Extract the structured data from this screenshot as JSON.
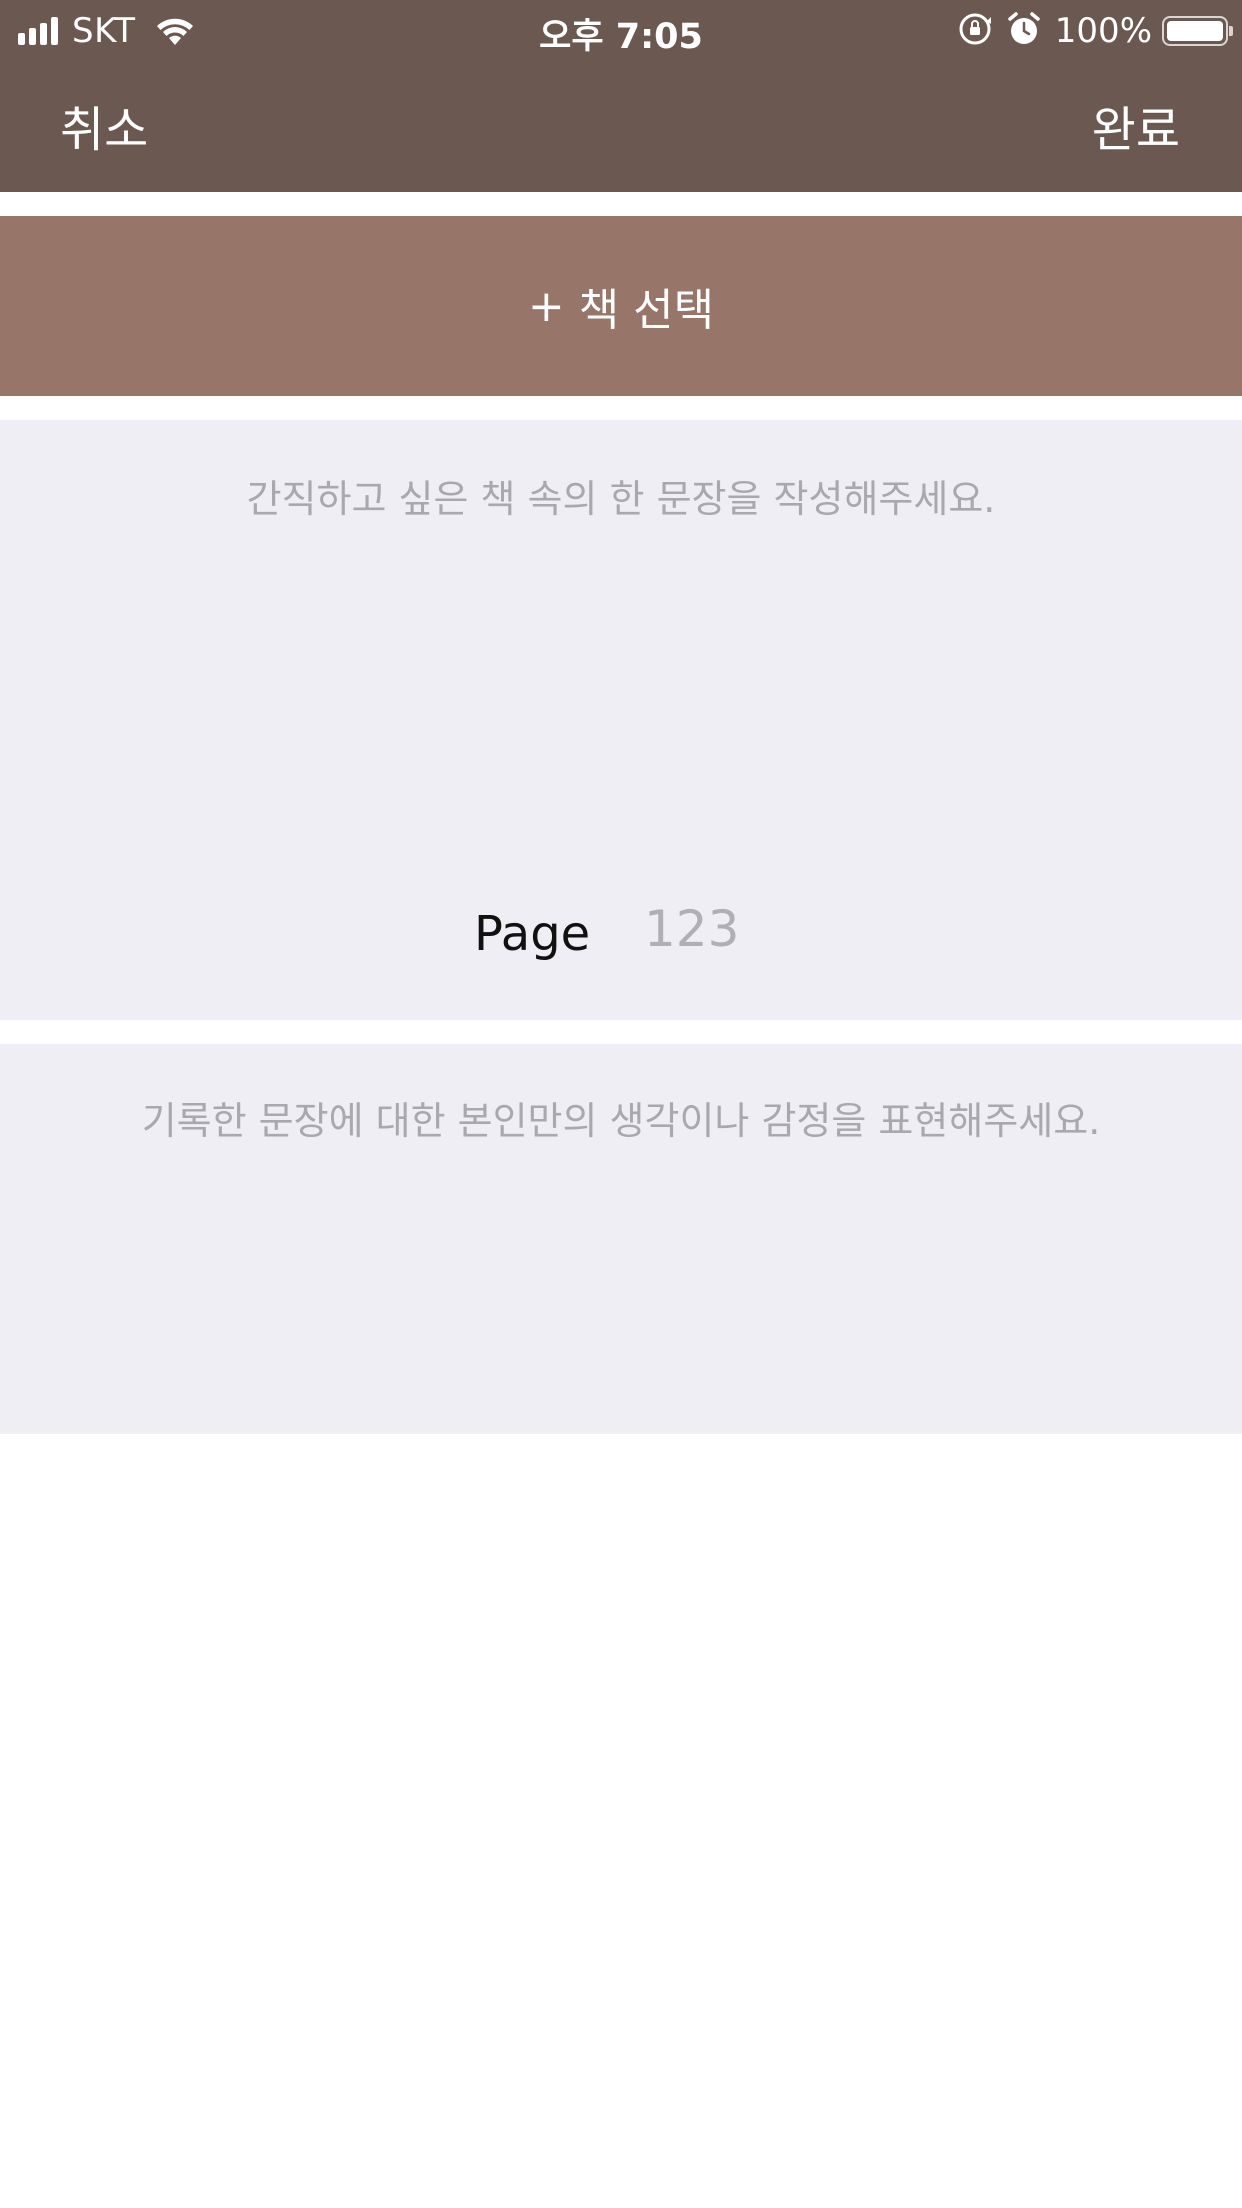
{
  "status_bar": {
    "carrier": "SKT",
    "time": "오후 7:05",
    "battery_percent": "100%",
    "battery_level": 1.0,
    "icons": [
      "signal-bars-icon",
      "wifi-icon",
      "rotation-lock-icon",
      "alarm-icon",
      "battery-icon"
    ]
  },
  "nav": {
    "cancel_label": "취소",
    "done_label": "완료"
  },
  "select_book": {
    "plus": "+",
    "label": "책 선택"
  },
  "sentence": {
    "placeholder": "간직하고 싶은 책 속의 한 문장을 작성해주세요."
  },
  "page": {
    "label": "Page",
    "placeholder": "123"
  },
  "thoughts": {
    "placeholder": "기록한 문장에 대한 본인만의 생각이나 감정을 표현해주세요."
  },
  "colors": {
    "header_bg": "#6b5951",
    "select_book_bg": "#977569",
    "panel_bg": "#efeef4",
    "placeholder_text": "#a9a8ae"
  }
}
